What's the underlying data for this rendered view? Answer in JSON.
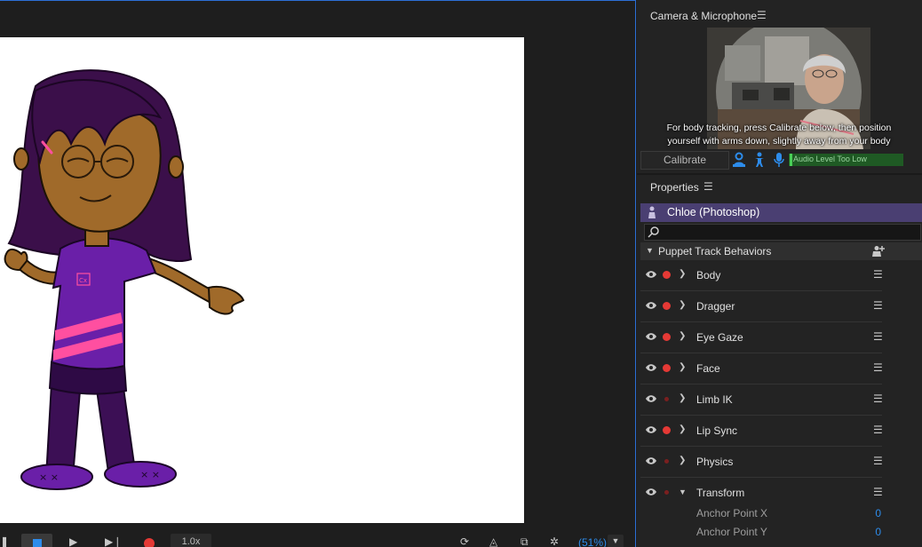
{
  "colors": {
    "accent": "#2d8ceb",
    "record_red": "#e53935",
    "puppet_bar": "#4a3f72",
    "meter_green": "#1f5a24"
  },
  "transport": {
    "speed": "1.0x",
    "zoom": "(51%)",
    "icons": [
      "pause-icon",
      "stop-icon",
      "play-icon",
      "step-icon",
      "record-icon",
      "refresh-icon",
      "mesh-icon",
      "export-icon",
      "render-icon",
      "chevron-down-icon"
    ]
  },
  "camera": {
    "title": "Camera & Microphone",
    "hint_line1": "For body tracking, press Calibrate below, then position",
    "hint_line2": "yourself with arms down, slightly away from your body",
    "calibrate_label": "Calibrate",
    "audio_label": "Audio Level Too Low",
    "audio_level": 0.02,
    "icons": [
      "body-tracking-icon",
      "person-icon",
      "microphone-icon"
    ]
  },
  "properties": {
    "title": "Properties",
    "puppet_name": "Chloe (Photoshop)",
    "search_placeholder": "",
    "section_title": "Puppet Track Behaviors",
    "behaviors": [
      {
        "label": "Body",
        "armed": true,
        "expanded": false
      },
      {
        "label": "Dragger",
        "armed": true,
        "expanded": false
      },
      {
        "label": "Eye Gaze",
        "armed": true,
        "expanded": false
      },
      {
        "label": "Face",
        "armed": true,
        "expanded": false
      },
      {
        "label": "Limb IK",
        "armed": false,
        "expanded": false
      },
      {
        "label": "Lip Sync",
        "armed": true,
        "expanded": false
      },
      {
        "label": "Physics",
        "armed": false,
        "expanded": false
      },
      {
        "label": "Transform",
        "armed": false,
        "expanded": true
      }
    ],
    "transform_params": [
      {
        "label": "Anchor Point X",
        "value": "0"
      },
      {
        "label": "Anchor Point Y",
        "value": "0"
      }
    ]
  },
  "puppet_badge": "Cx"
}
